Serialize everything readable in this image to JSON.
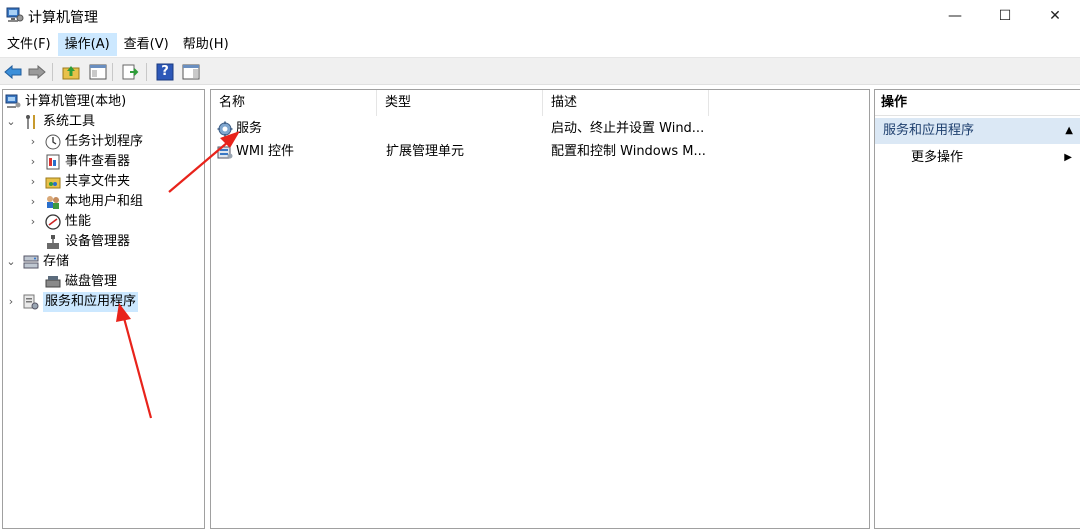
{
  "window": {
    "title": "计算机管理",
    "minimize_glyph": "—",
    "maximize_glyph": "☐",
    "close_glyph": "✕"
  },
  "menu": [
    {
      "label": "文件(F)"
    },
    {
      "label": "操作(A)"
    },
    {
      "label": "查看(V)"
    },
    {
      "label": "帮助(H)"
    }
  ],
  "toolbar": {
    "icons": [
      "back-arrow-icon",
      "forward-arrow-icon",
      "up-folder-icon",
      "show-hide-tree-icon",
      "export-list-icon",
      "help-icon",
      "show-hide-action-pane-icon"
    ],
    "help_glyph": "?"
  },
  "tree": {
    "root": "计算机管理(本地)",
    "items": [
      {
        "label": "系统工具",
        "expander": "⌄"
      },
      {
        "label": "任务计划程序",
        "expander": "›"
      },
      {
        "label": "事件查看器",
        "expander": "›"
      },
      {
        "label": "共享文件夹",
        "expander": "›"
      },
      {
        "label": "本地用户和组",
        "expander": "›"
      },
      {
        "label": "性能",
        "expander": "›"
      },
      {
        "label": "设备管理器",
        "expander": ""
      },
      {
        "label": "存储",
        "expander": "⌄"
      },
      {
        "label": "磁盘管理",
        "expander": ""
      },
      {
        "label": "服务和应用程序",
        "expander": "›"
      }
    ]
  },
  "list": {
    "columns": [
      "名称",
      "类型",
      "描述"
    ],
    "rows": [
      {
        "name": "服务",
        "type": "",
        "desc": "启动、终止并设置 Wind..."
      },
      {
        "name": "WMI 控件",
        "type": "扩展管理单元",
        "desc": "配置和控制 Windows M..."
      }
    ]
  },
  "actions": {
    "header": "操作",
    "group": "服务和应用程序",
    "group_caret": "▲",
    "more": "更多操作",
    "more_caret": "▶"
  },
  "colors": {
    "selection": "#cce8ff",
    "action_group_bg": "#dbe8f5",
    "annotation_arrow": "#e8231b"
  }
}
